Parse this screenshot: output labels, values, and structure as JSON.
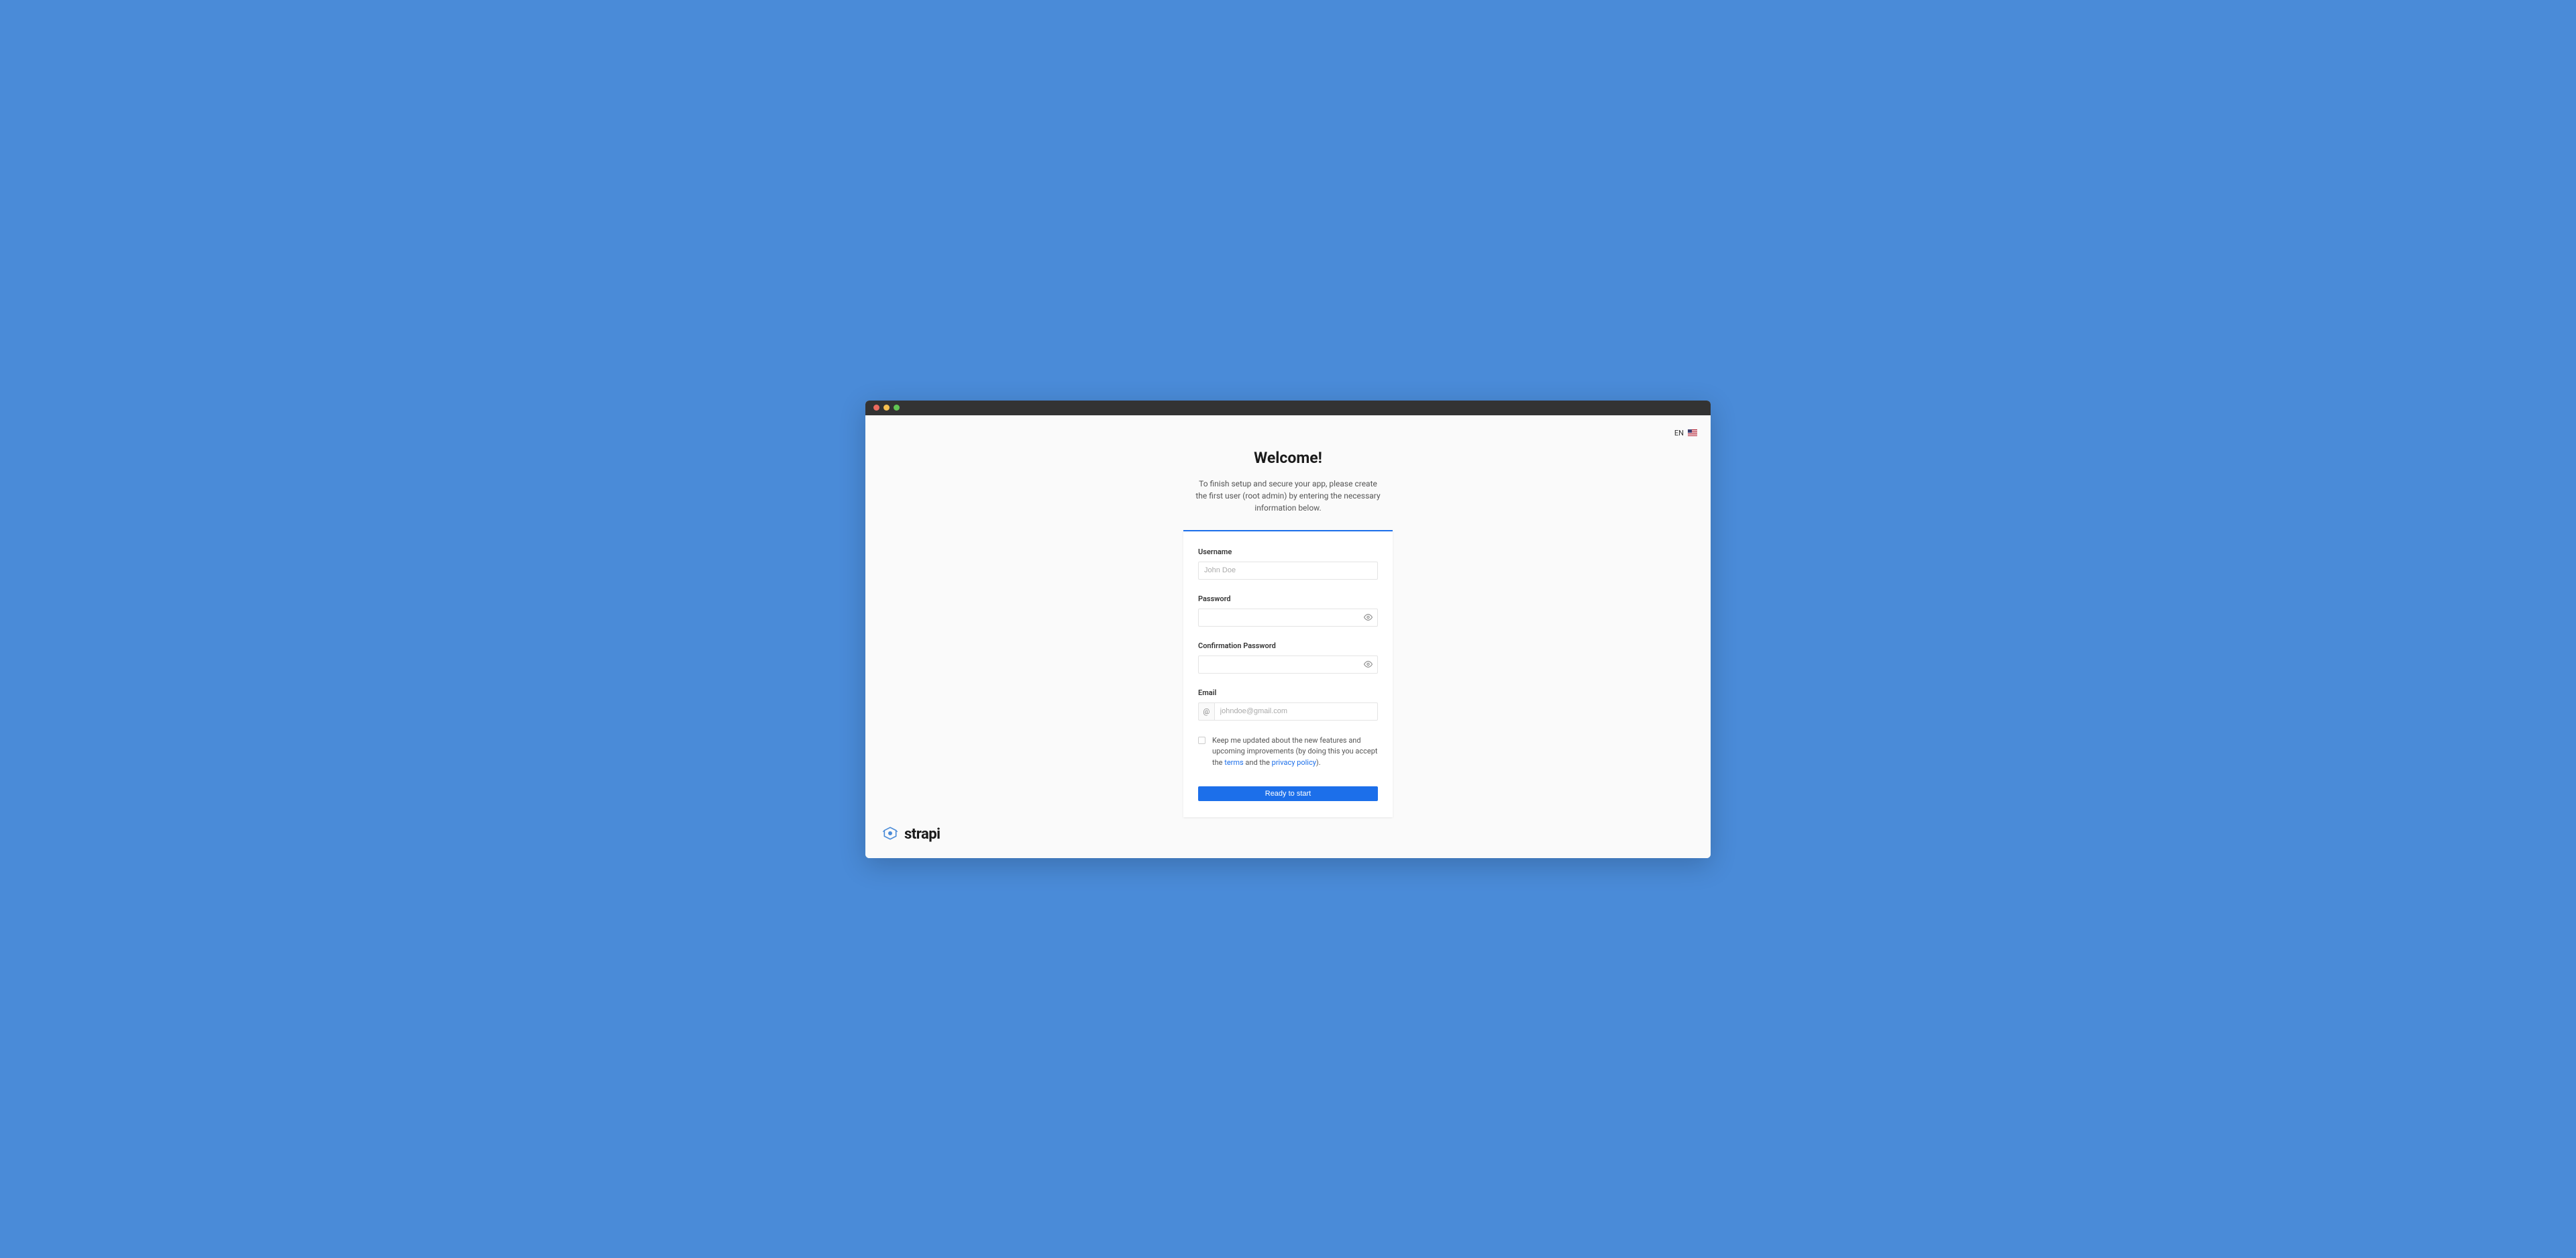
{
  "language": {
    "code": "EN"
  },
  "header": {
    "title": "Welcome!",
    "subtitle": "To finish setup and secure your app, please create the first user (root admin) by entering the necessary information below."
  },
  "form": {
    "username": {
      "label": "Username",
      "placeholder": "John Doe",
      "value": ""
    },
    "password": {
      "label": "Password",
      "value": ""
    },
    "confirm_password": {
      "label": "Confirmation Password",
      "value": ""
    },
    "email": {
      "label": "Email",
      "addon": "@",
      "placeholder": "johndoe@gmail.com",
      "value": ""
    },
    "newsletter": {
      "text_before": "Keep me updated about the new features and upcoming improvements (by doing this you accept the ",
      "terms_link": "terms",
      "text_middle": " and the ",
      "privacy_link": "privacy policy",
      "text_after": ")."
    },
    "submit_label": "Ready to start"
  },
  "brand": {
    "name": "strapi"
  }
}
